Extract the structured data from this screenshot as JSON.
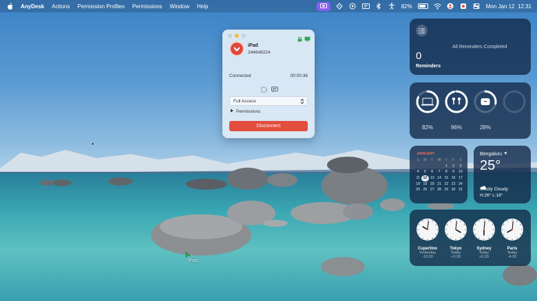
{
  "menubar": {
    "app_name": "AnyDesk",
    "menus": [
      "Actions",
      "Permission Profiles",
      "Permissions",
      "Window",
      "Help"
    ],
    "battery_percent": "82%",
    "battery_level": 0.82,
    "datetime": "Mon Jan 12  12:31",
    "status_icons": [
      "screen-share-icon",
      "location-icon",
      "play-icon",
      "display-icon",
      "bluetooth-icon",
      "accessibility-icon",
      "battery-icon",
      "wifi-icon",
      "user-icon",
      "flag-icon",
      "control-center-icon"
    ]
  },
  "session": {
    "peer_name": "iPad",
    "peer_id": "244648224",
    "status": "Connected",
    "duration": "00:00:36",
    "access_profile": "Full Access",
    "permissions_label": "Permissions",
    "disconnect_label": "Disconnect"
  },
  "widgets": {
    "reminders": {
      "count": "0",
      "label": "Reminders",
      "message": "All Reminders Completed"
    },
    "batteries": [
      {
        "device": "laptop-icon",
        "value": "82%",
        "level": 0.82
      },
      {
        "device": "airpods-icon",
        "value": "96%",
        "level": 0.96
      },
      {
        "device": "case-icon",
        "value": "28%",
        "level": 0.28
      },
      {
        "device": "empty-slot",
        "value": "",
        "level": 0
      }
    ],
    "calendar": {
      "month": "JANUARY",
      "weekdays": [
        "S",
        "M",
        "T",
        "W",
        "T",
        "F",
        "S"
      ],
      "weeks": [
        [
          "",
          "",
          "",
          "",
          "1",
          "2",
          "3"
        ],
        [
          "4",
          "5",
          "6",
          "7",
          "8",
          "9",
          "10"
        ],
        [
          "11",
          "12",
          "13",
          "14",
          "15",
          "16",
          "17"
        ],
        [
          "18",
          "19",
          "20",
          "21",
          "22",
          "23",
          "24"
        ],
        [
          "25",
          "26",
          "27",
          "28",
          "29",
          "30",
          "31"
        ]
      ],
      "today": "12"
    },
    "weather": {
      "city": "Bengaluru",
      "temperature": "25°",
      "condition": "Mostly Cloudy",
      "range": "H:26° L:18°"
    },
    "clocks": [
      {
        "city": "Cupertino",
        "day": "Yesterday",
        "offset": "-13:30",
        "hour": 10,
        "minute": 1
      },
      {
        "city": "Tokyo",
        "day": "Today",
        "offset": "+3:30",
        "hour": 4,
        "minute": 1
      },
      {
        "city": "Sydney",
        "day": "Today",
        "offset": "+5:30",
        "hour": 6,
        "minute": 1
      },
      {
        "city": "Paris",
        "day": "Today",
        "offset": "-4:30",
        "hour": 8,
        "minute": 1
      }
    ]
  },
  "desktop": {
    "cursor_label": "iPad"
  },
  "colors": {
    "accent_red": "#e24d3e",
    "menubar_active": "#8b5cf6",
    "calendar_month": "#f26b5b"
  }
}
